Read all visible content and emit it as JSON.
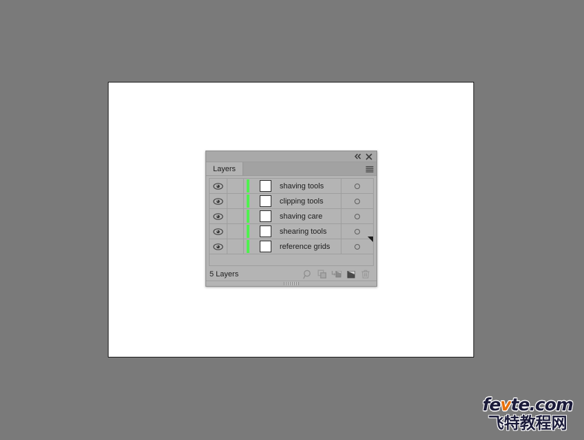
{
  "canvas": {
    "background_color": "#7a7a7a",
    "artboard_color": "#ffffff",
    "artboard_border_color": "#1a1a1a"
  },
  "panel": {
    "tab_label": "Layers",
    "titlebar": {
      "collapse_icon": "double-chevron-left-icon",
      "close_icon": "close-icon"
    },
    "menu_icon": "hamburger-menu-icon",
    "columns": {
      "visibility": "eye-icon",
      "lock": "lock-column",
      "color": "layer-color-strip",
      "thumbnail": "layer-thumbnail",
      "name": "layer-name",
      "target": "target-circle-icon"
    },
    "layer_color": "#4ff04f",
    "thumbnail_fill": "#ffffff",
    "layers": [
      {
        "name": "shaving tools",
        "visible": true,
        "locked": false,
        "color": "#4ff04f",
        "targeted": false
      },
      {
        "name": "clipping tools",
        "visible": true,
        "locked": false,
        "color": "#4ff04f",
        "targeted": false
      },
      {
        "name": "shaving care",
        "visible": true,
        "locked": false,
        "color": "#4ff04f",
        "targeted": false
      },
      {
        "name": "shearing tools",
        "visible": true,
        "locked": false,
        "color": "#4ff04f",
        "targeted": false
      },
      {
        "name": "reference grids",
        "visible": true,
        "locked": false,
        "color": "#4ff04f",
        "targeted": false
      }
    ],
    "footer": {
      "count_label": "5 Layers",
      "buttons": [
        {
          "name": "locate-object-button",
          "icon": "magnifier-icon"
        },
        {
          "name": "make-clipping-mask-button",
          "icon": "overlapping-squares-icon"
        },
        {
          "name": "create-new-sublayer-button",
          "icon": "new-sublayer-icon"
        },
        {
          "name": "create-new-layer-button",
          "icon": "new-layer-icon"
        },
        {
          "name": "delete-selection-button",
          "icon": "trash-icon"
        }
      ]
    },
    "resize_grip": "resize-grip"
  },
  "watermark": {
    "line1_pre": "fe",
    "line1_v": "v",
    "line1_post": "te.com",
    "line2": "飞特教程网",
    "accent_color": "#e8700a",
    "text_color": "#1b1b3a"
  }
}
